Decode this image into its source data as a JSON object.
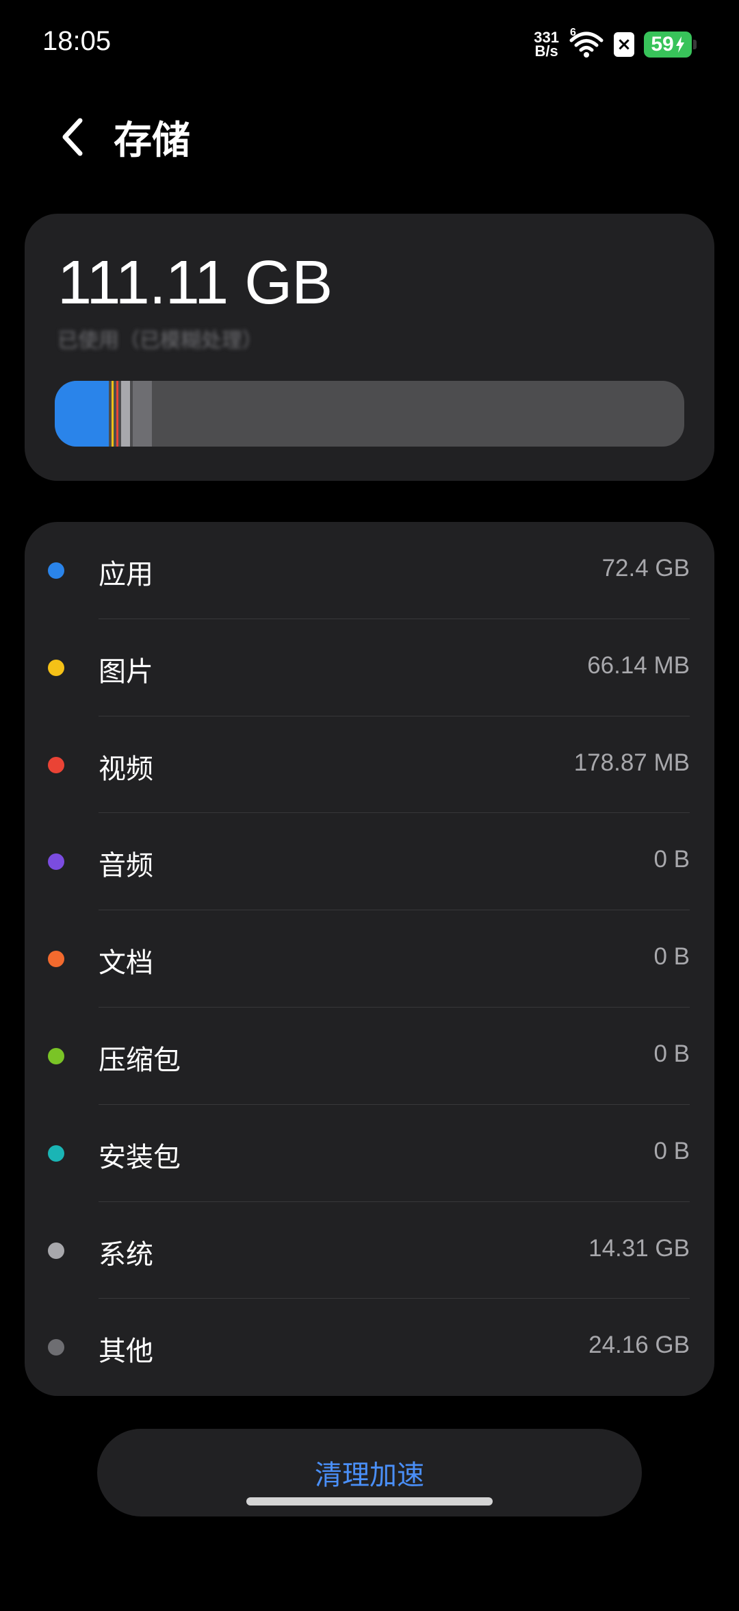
{
  "status_bar": {
    "time": "18:05",
    "net_speed_value": "331",
    "net_speed_unit": "B/s",
    "wifi_badge": "6",
    "battery_level": "59",
    "icons": [
      "wifi-icon",
      "sim-disabled-icon",
      "battery-charging-icon"
    ]
  },
  "header": {
    "title": "存储",
    "back_icon": "chevron-left-icon"
  },
  "summary": {
    "total": "111.11 GB",
    "used_hint": "已使用（已模糊处理）"
  },
  "usage_segments": [
    {
      "name": "应用",
      "color": "#2a84ea",
      "fraction": 0.0905
    },
    {
      "name": "图片",
      "color": "#f5c117",
      "fraction": 0.0075
    },
    {
      "name": "视频",
      "color": "#ea4335",
      "fraction": 0.0075
    },
    {
      "name": "系统",
      "color": "#a8a8ac",
      "fraction": 0.018
    },
    {
      "name": "其他",
      "color": "#6e6e72",
      "fraction": 0.03
    }
  ],
  "categories": [
    {
      "label": "应用",
      "size": "72.4 GB",
      "color": "#2a84ea"
    },
    {
      "label": "图片",
      "size": "66.14 MB",
      "color": "#f5c117"
    },
    {
      "label": "视频",
      "size": "178.87 MB",
      "color": "#ea4335"
    },
    {
      "label": "音频",
      "size": "0 B",
      "color": "#7b4ce0"
    },
    {
      "label": "文档",
      "size": "0 B",
      "color": "#f26a2e"
    },
    {
      "label": "压缩包",
      "size": "0 B",
      "color": "#7ac426"
    },
    {
      "label": "安装包",
      "size": "0 B",
      "color": "#1ab5b5"
    },
    {
      "label": "系统",
      "size": "14.31 GB",
      "color": "#a8a8ac"
    },
    {
      "label": "其他",
      "size": "24.16 GB",
      "color": "#6e6e72"
    }
  ],
  "actions": {
    "clean_label": "清理加速"
  }
}
